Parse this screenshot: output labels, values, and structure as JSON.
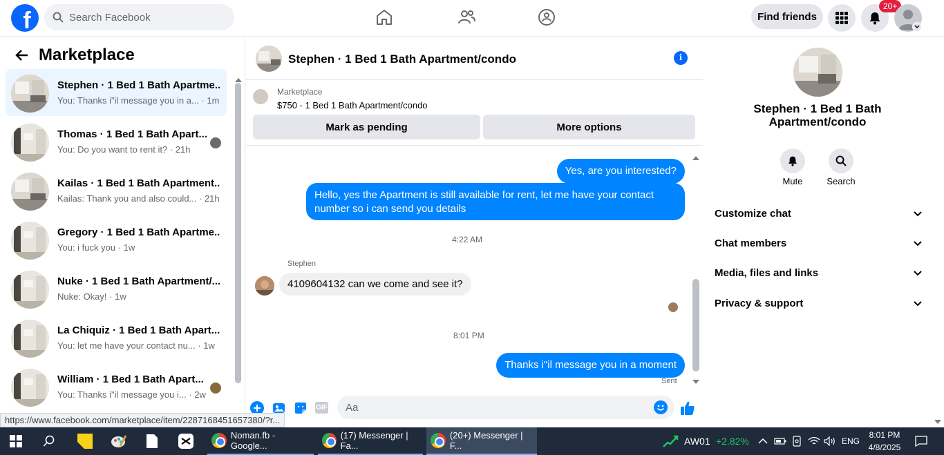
{
  "topbar": {
    "search_placeholder": "Search Facebook",
    "find_friends": "Find friends",
    "notifications_badge": "20+",
    "logo_letter": "f"
  },
  "left": {
    "title": "Marketplace",
    "conversations": [
      {
        "name": "Stephen · 1 Bed 1 Bath Apartme...",
        "message": "You: Thanks i\"il message you in a...",
        "time": "· 1m",
        "active": true
      },
      {
        "name": "Thomas · 1 Bed 1 Bath Apart...",
        "message": "You: Do you want to rent it?",
        "time": "· 21h"
      },
      {
        "name": "Kailas · 1 Bed 1 Bath Apartment...",
        "message": "Kailas: Thank you and also could...",
        "time": "· 21h"
      },
      {
        "name": "Gregory · 1 Bed 1 Bath Apartme...",
        "message": "You: i fuck you",
        "time": "· 1w"
      },
      {
        "name": "Nuke · 1 Bed 1 Bath Apartment/...",
        "message": "Nuke: Okay!",
        "time": "· 1w"
      },
      {
        "name": "La Chiquiz · 1 Bed 1 Bath Apart...",
        "message": "You: let me have your contact nu...",
        "time": "· 1w"
      },
      {
        "name": "William · 1 Bed 1 Bath Apart...",
        "message": "You: Thanks i\"il message you i...",
        "time": "· 2w"
      }
    ]
  },
  "chat": {
    "title": "Stephen · 1 Bed 1 Bath Apartment/condo",
    "listing_source": "Marketplace",
    "listing_price": "$750 - 1 Bed 1 Bath Apartment/condo",
    "mark_pending": "Mark as pending",
    "more_options": "More options",
    "messages": {
      "m1": "Yes, are you interested?",
      "m2": "Hello, yes the Apartment is still available for rent, let me have your contact number so i can send you details",
      "ts1": "4:22 AM",
      "sender": "Stephen",
      "m3": "4109604132  can we come and see it?",
      "ts2": "8:01 PM",
      "m4": "Thanks i\"il message you in a moment",
      "status": "Sent"
    },
    "composer_placeholder": "Aa"
  },
  "right": {
    "title": "Stephen · 1 Bed 1 Bath Apartment/condo",
    "mute": "Mute",
    "search": "Search",
    "sections": [
      "Customize chat",
      "Chat members",
      "Media, files and links",
      "Privacy & support"
    ]
  },
  "status_url": "https://www.facebook.com/marketplace/item/2287168451657380/?r...",
  "taskbar": {
    "apps": [
      "Noman.fb - Google...",
      "(17) Messenger | Fa...",
      "(20+) Messenger | F..."
    ],
    "stock_name": "AW01",
    "stock_change": "+2.82%",
    "language": "ENG",
    "time": "8:01 PM",
    "date": "4/8/2025"
  },
  "colors": {
    "brand": "#0866ff",
    "bubble": "#0084ff",
    "taskbar": "#1f2a3a"
  }
}
